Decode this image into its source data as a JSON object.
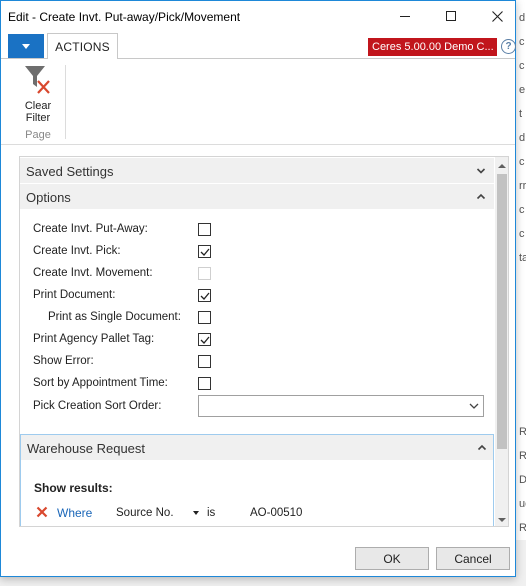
{
  "window": {
    "title": "Edit - Create Invt. Put-away/Pick/Movement",
    "company_badge": "Ceres 5.00.00 Demo C..."
  },
  "ribbon": {
    "tab_actions": "ACTIONS",
    "clear_filter_line1": "Clear",
    "clear_filter_line2": "Filter",
    "group_label": "Page",
    "icons": {
      "app_menu": "chevron-down-icon",
      "clear_filter": "funnel-remove-icon",
      "help": "help-icon"
    }
  },
  "sections": {
    "saved_settings": "Saved Settings",
    "options": "Options",
    "warehouse_request": "Warehouse Request"
  },
  "options": {
    "create_putaway": {
      "label": "Create Invt. Put-Away:",
      "checked": false
    },
    "create_pick": {
      "label": "Create Invt. Pick:",
      "checked": true
    },
    "create_movement": {
      "label": "Create Invt. Movement:",
      "checked": false,
      "disabled": true
    },
    "print_document": {
      "label": "Print Document:",
      "checked": true
    },
    "print_single": {
      "label": "Print as Single Document:",
      "checked": false
    },
    "print_agency_pallet": {
      "label": "Print Agency Pallet Tag:",
      "checked": true
    },
    "show_error": {
      "label": "Show Error:",
      "checked": false
    },
    "sort_by_appt": {
      "label": "Sort by Appointment Time:",
      "checked": false
    },
    "pick_sort_order": {
      "label": "Pick Creation Sort Order:",
      "value": ""
    }
  },
  "warehouse_request": {
    "show_results": "Show results:",
    "where": "Where",
    "field": "Source No.",
    "operator": "is",
    "value": "AO-00510"
  },
  "buttons": {
    "ok": "OK",
    "cancel": "Cancel"
  },
  "background_fragments": [
    "d",
    "c",
    "c",
    "e",
    "t",
    "d",
    "c",
    "rr",
    "c",
    "c",
    "ta",
    "R",
    "R",
    "Da",
    "ue",
    "R"
  ]
}
